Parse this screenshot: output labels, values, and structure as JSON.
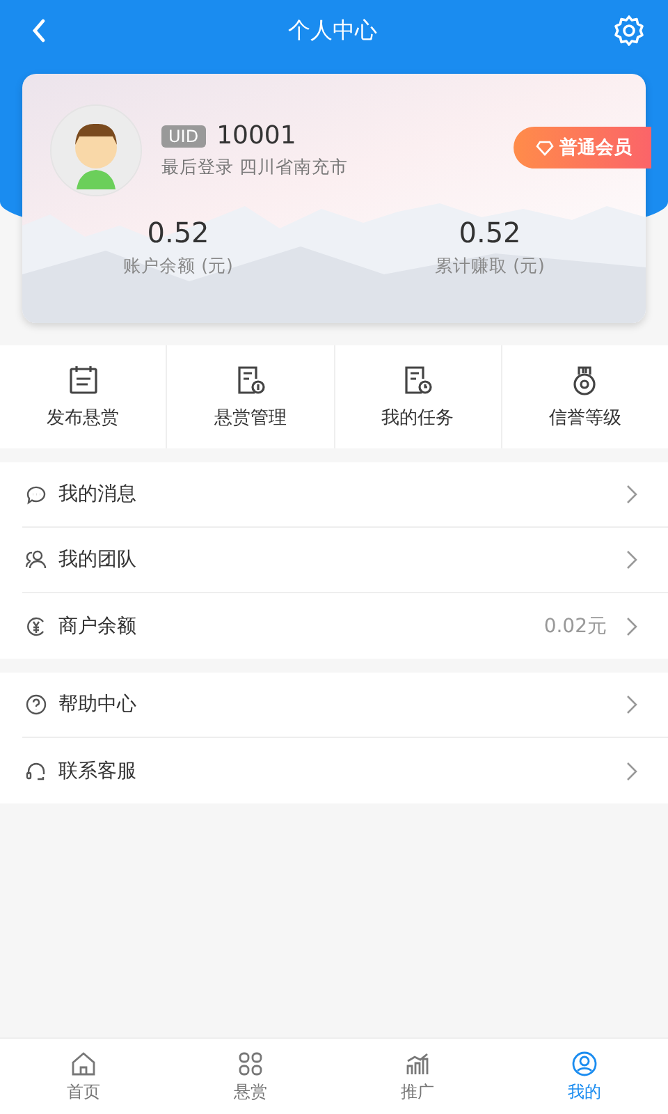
{
  "header": {
    "title": "个人中心"
  },
  "profile": {
    "uid_label": "UID",
    "uid": "10001",
    "last_login": "最后登录 四川省南充市",
    "badge": "普通会员",
    "stats": [
      {
        "value": "0.52",
        "label": "账户余额 (元)"
      },
      {
        "value": "0.52",
        "label": "累计赚取 (元)"
      }
    ]
  },
  "shortcuts": [
    {
      "label": "发布悬赏"
    },
    {
      "label": "悬赏管理"
    },
    {
      "label": "我的任务"
    },
    {
      "label": "信誉等级"
    }
  ],
  "menu_groups": [
    {
      "items": [
        {
          "label": "我的消息"
        },
        {
          "label": "我的团队"
        },
        {
          "label": "商户余额",
          "value": "0.02元"
        }
      ]
    },
    {
      "items": [
        {
          "label": "帮助中心"
        },
        {
          "label": "联系客服"
        }
      ]
    }
  ],
  "tab_bar": [
    {
      "label": "首页",
      "selected": false
    },
    {
      "label": "悬赏",
      "selected": false
    },
    {
      "label": "推广",
      "selected": false
    },
    {
      "label": "我的",
      "selected": true
    }
  ]
}
